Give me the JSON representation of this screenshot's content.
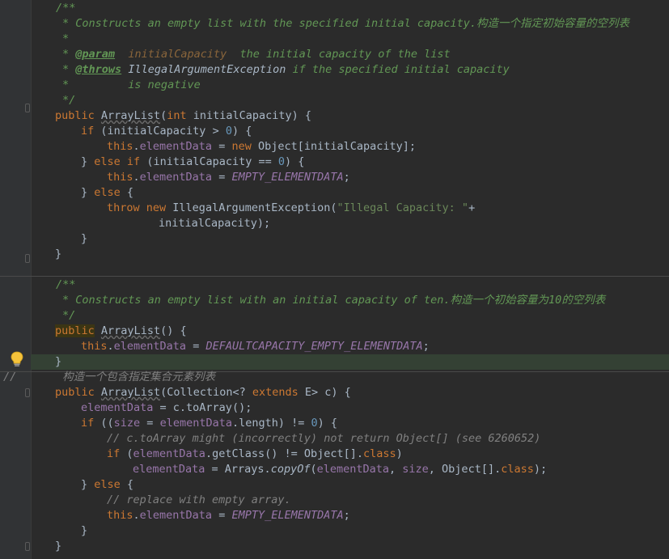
{
  "editor": {
    "block1": {
      "open": "/**",
      "desc": "* Constructs an empty list with the specified initial capacity.构造一个指定初始容量的空列表",
      "star": "*",
      "param_tag": "@param",
      "param_name": "initialCapacity",
      "param_desc": "the initial capacity of the list",
      "throws_tag": "@throws",
      "throws_type": "IllegalArgumentException",
      "throws_desc": "if the specified initial capacity",
      "throws_cont": "is negative",
      "close": "*/",
      "l_sig": "public ArrayList(int initialCapacity) {",
      "l_if": "if (initialCapacity > 0) {",
      "l_assign1": "this.elementData = new Object[initialCapacity];",
      "l_elseif": "} else if (initialCapacity == 0) {",
      "l_assign2": "this.elementData = EMPTY_ELEMENTDATA;",
      "l_else": "} else {",
      "l_throw": "throw new IllegalArgumentException(\"Illegal Capacity: \"+",
      "l_throw_cont": "initialCapacity);",
      "l_close_inner": "}",
      "l_close": "}"
    },
    "block2": {
      "open": "/**",
      "desc": "* Constructs an empty list with an initial capacity of ten.构造一个初始容量为10的空列表",
      "close": "*/",
      "l_sig": "public ArrayList() {",
      "l_assign": "this.elementData = DEFAULTCAPACITY_EMPTY_ELEMENTDATA;",
      "l_close": "}"
    },
    "block3": {
      "line_comment": "//       构造一个包含指定集合元素列表",
      "l_sig": "public ArrayList(Collection<? extends E> c) {",
      "l_elem": "elementData = c.toArray();",
      "l_if": "if ((size = elementData.length) != 0) {",
      "l_comment1": "// c.toArray might (incorrectly) not return Object[] (see 6260652)",
      "l_if2": "if (elementData.getClass() != Object[].class)",
      "l_copy": "elementData = Arrays.copyOf(elementData, size, Object[].class);",
      "l_else": "} else {",
      "l_comment2": "// replace with empty array.",
      "l_assign": "this.elementData = EMPTY_ELEMENTDATA;",
      "l_close_inner": "}",
      "l_close": "}"
    },
    "intention_icon": "lightbulb-icon",
    "colors": {
      "background": "#2b2b2b",
      "keyword": "#cc7832",
      "doc_comment": "#629755",
      "number": "#6897bb",
      "field": "#9876aa",
      "string": "#6a8759",
      "line_comment": "#808080",
      "text": "#a9b7c6"
    }
  }
}
